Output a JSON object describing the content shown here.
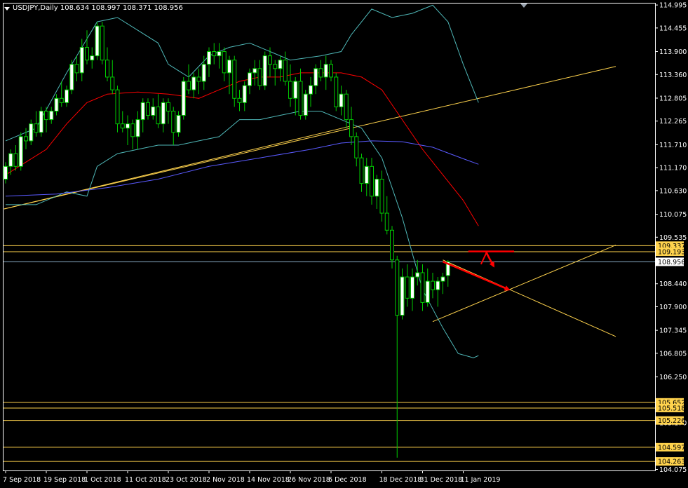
{
  "header": {
    "symbol_line": "USDJPY,Daily  108.634 108.997 108.371 108.956"
  },
  "colors": {
    "background": "#000000",
    "grid_border": "#ffffff",
    "bull_candle": "#ffffff",
    "bear_candle": "#000000",
    "wick": "#00cc00",
    "bollinger": "#4fb8b8",
    "ma_red": "#ff0000",
    "ma_blue": "#5a5aff",
    "trendline": "#ffd34d",
    "level_line": "#ffd34d",
    "price_line": "#8aaec8",
    "arrow": "#ff0000"
  },
  "chart_data": {
    "type": "candlestick",
    "symbol": "USDJPY",
    "timeframe": "Daily",
    "ohlc_header": {
      "open": 108.634,
      "high": 108.997,
      "low": 108.371,
      "close": 108.956
    },
    "ylim": [
      104.05,
      115.03
    ],
    "y_ticks": [
      114.995,
      114.455,
      113.9,
      113.36,
      112.805,
      112.265,
      111.71,
      111.17,
      110.63,
      110.075,
      109.535,
      108.44,
      107.9,
      107.345,
      106.805,
      106.25,
      105.17,
      104.075
    ],
    "x_ticks": [
      {
        "bar": 0,
        "label": "7 Sep 2018"
      },
      {
        "bar": 8,
        "label": "19 Sep 2018"
      },
      {
        "bar": 16,
        "label": "1 Oct 2018"
      },
      {
        "bar": 24,
        "label": "11 Oct 2018"
      },
      {
        "bar": 32,
        "label": "23 Oct 2018"
      },
      {
        "bar": 40,
        "label": "2 Nov 2018"
      },
      {
        "bar": 48,
        "label": "14 Nov 2018"
      },
      {
        "bar": 56,
        "label": "26 Nov 2018"
      },
      {
        "bar": 64,
        "label": "6 Dec 2018"
      },
      {
        "bar": 74,
        "label": "18 Dec 2018"
      },
      {
        "bar": 82,
        "label": "31 Dec 2018"
      },
      {
        "bar": 90,
        "label": "11 Jan 2019"
      }
    ],
    "current_price": 108.956,
    "levels": [
      {
        "price": 109.337,
        "label": "109.337"
      },
      {
        "price": 109.193,
        "label": "109.193"
      },
      {
        "price": 105.652,
        "label": "105.652"
      },
      {
        "price": 105.518,
        "label": "105.518"
      },
      {
        "price": 105.226,
        "label": "105.226"
      },
      {
        "price": 104.597,
        "label": "104.597"
      },
      {
        "price": 104.263,
        "label": "104.263"
      }
    ],
    "candles": [
      [
        110.9,
        111.3,
        110.8,
        111.2
      ],
      [
        111.2,
        111.6,
        111.0,
        111.5
      ],
      [
        111.5,
        111.7,
        111.1,
        111.2
      ],
      [
        111.2,
        112.0,
        111.1,
        111.9
      ],
      [
        111.9,
        112.1,
        111.6,
        111.8
      ],
      [
        111.8,
        112.3,
        111.7,
        112.2
      ],
      [
        112.2,
        112.5,
        111.9,
        112.0
      ],
      [
        112.0,
        112.6,
        111.9,
        112.5
      ],
      [
        112.5,
        112.6,
        112.0,
        112.3
      ],
      [
        112.3,
        112.6,
        112.2,
        112.5
      ],
      [
        112.5,
        112.9,
        112.4,
        112.8
      ],
      [
        112.8,
        113.2,
        112.6,
        112.7
      ],
      [
        112.7,
        113.1,
        112.6,
        113.0
      ],
      [
        113.0,
        113.7,
        112.9,
        113.6
      ],
      [
        113.6,
        113.8,
        113.2,
        113.4
      ],
      [
        113.4,
        114.2,
        113.2,
        114.0
      ],
      [
        114.0,
        114.4,
        113.6,
        113.7
      ],
      [
        113.7,
        114.0,
        113.5,
        113.8
      ],
      [
        113.8,
        114.6,
        113.7,
        114.5
      ],
      [
        114.5,
        114.6,
        113.6,
        113.7
      ],
      [
        113.7,
        114.0,
        113.2,
        113.3
      ],
      [
        113.3,
        113.7,
        112.9,
        113.0
      ],
      [
        113.0,
        113.1,
        112.0,
        112.2
      ],
      [
        112.2,
        112.5,
        112.0,
        112.1
      ],
      [
        112.1,
        112.4,
        111.7,
        112.2
      ],
      [
        112.2,
        112.3,
        111.6,
        111.9
      ],
      [
        111.9,
        112.5,
        111.6,
        112.3
      ],
      [
        112.3,
        112.8,
        112.0,
        112.7
      ],
      [
        112.7,
        112.8,
        112.3,
        112.4
      ],
      [
        112.4,
        112.8,
        112.3,
        112.6
      ],
      [
        112.6,
        112.9,
        112.1,
        112.2
      ],
      [
        112.2,
        112.8,
        112.0,
        112.7
      ],
      [
        112.7,
        112.8,
        112.2,
        112.5
      ],
      [
        112.5,
        112.6,
        111.7,
        112.0
      ],
      [
        112.0,
        112.5,
        111.9,
        112.4
      ],
      [
        112.4,
        113.3,
        112.3,
        113.2
      ],
      [
        113.2,
        113.6,
        112.9,
        113.0
      ],
      [
        113.0,
        113.4,
        112.8,
        113.3
      ],
      [
        113.3,
        113.5,
        112.9,
        113.2
      ],
      [
        113.2,
        113.8,
        113.0,
        113.6
      ],
      [
        113.6,
        114.0,
        113.3,
        113.9
      ],
      [
        113.9,
        114.1,
        113.6,
        113.8
      ],
      [
        113.8,
        114.1,
        113.5,
        113.9
      ],
      [
        113.9,
        114.0,
        113.2,
        113.4
      ],
      [
        113.4,
        113.8,
        112.9,
        113.7
      ],
      [
        113.7,
        113.8,
        112.6,
        112.8
      ],
      [
        112.8,
        113.0,
        112.5,
        112.7
      ],
      [
        112.7,
        113.2,
        112.5,
        113.1
      ],
      [
        113.1,
        113.5,
        112.9,
        113.4
      ],
      [
        113.4,
        113.7,
        113.1,
        113.5
      ],
      [
        113.5,
        113.7,
        113.0,
        113.1
      ],
      [
        113.1,
        113.9,
        113.0,
        113.8
      ],
      [
        113.8,
        114.0,
        113.3,
        113.6
      ],
      [
        113.6,
        113.7,
        113.1,
        113.5
      ],
      [
        113.5,
        113.8,
        113.2,
        113.7
      ],
      [
        113.7,
        113.9,
        113.1,
        113.2
      ],
      [
        113.2,
        113.6,
        112.6,
        112.8
      ],
      [
        112.8,
        113.3,
        112.4,
        113.2
      ],
      [
        113.2,
        113.5,
        112.3,
        112.4
      ],
      [
        112.4,
        113.0,
        112.3,
        112.9
      ],
      [
        112.9,
        113.3,
        112.6,
        113.1
      ],
      [
        113.1,
        113.6,
        112.9,
        113.5
      ],
      [
        113.5,
        113.7,
        113.2,
        113.3
      ],
      [
        113.3,
        113.8,
        113.0,
        113.6
      ],
      [
        113.6,
        113.7,
        113.2,
        113.3
      ],
      [
        113.3,
        113.4,
        112.5,
        112.6
      ],
      [
        112.6,
        113.1,
        112.4,
        112.9
      ],
      [
        112.9,
        113.0,
        112.1,
        112.3
      ],
      [
        112.3,
        112.6,
        111.7,
        111.9
      ],
      [
        111.9,
        112.0,
        111.2,
        111.4
      ],
      [
        111.4,
        111.5,
        110.6,
        110.8
      ],
      [
        110.8,
        111.4,
        110.5,
        111.2
      ],
      [
        111.2,
        111.4,
        110.3,
        110.5
      ],
      [
        110.5,
        111.0,
        110.2,
        110.9
      ],
      [
        110.9,
        111.1,
        109.9,
        110.1
      ],
      [
        110.1,
        110.5,
        109.6,
        109.7
      ],
      [
        109.7,
        109.8,
        108.8,
        109.0
      ],
      [
        109.0,
        109.1,
        104.35,
        107.7
      ],
      [
        107.7,
        108.8,
        107.6,
        108.6
      ],
      [
        108.6,
        108.9,
        107.9,
        108.1
      ],
      [
        108.1,
        108.8,
        107.8,
        108.6
      ],
      [
        108.6,
        109.0,
        108.4,
        108.7
      ],
      [
        108.7,
        108.9,
        107.8,
        108.0
      ],
      [
        108.0,
        108.8,
        107.9,
        108.5
      ],
      [
        108.5,
        108.7,
        108.1,
        108.3
      ],
      [
        108.3,
        108.6,
        107.9,
        108.5
      ],
      [
        108.5,
        108.7,
        108.2,
        108.6
      ],
      [
        108.634,
        108.997,
        108.371,
        108.956
      ]
    ],
    "bollinger_upper": [
      [
        0,
        111.8
      ],
      [
        6,
        112.1
      ],
      [
        12,
        113.4
      ],
      [
        18,
        114.6
      ],
      [
        22,
        114.7
      ],
      [
        26,
        114.4
      ],
      [
        30,
        114.1
      ],
      [
        32,
        113.6
      ],
      [
        36,
        113.3
      ],
      [
        40,
        113.8
      ],
      [
        44,
        114.0
      ],
      [
        48,
        114.1
      ],
      [
        52,
        113.9
      ],
      [
        56,
        113.7
      ],
      [
        62,
        113.8
      ],
      [
        66,
        113.9
      ],
      [
        68,
        114.3
      ],
      [
        72,
        114.9
      ],
      [
        76,
        114.7
      ],
      [
        80,
        114.8
      ],
      [
        84,
        114.99
      ],
      [
        87,
        114.6
      ],
      [
        90,
        113.6
      ],
      [
        93,
        112.7
      ]
    ],
    "bollinger_lower": [
      [
        0,
        110.3
      ],
      [
        6,
        110.3
      ],
      [
        12,
        110.6
      ],
      [
        16,
        110.5
      ],
      [
        18,
        111.2
      ],
      [
        22,
        111.5
      ],
      [
        26,
        111.6
      ],
      [
        30,
        111.7
      ],
      [
        34,
        111.7
      ],
      [
        38,
        111.8
      ],
      [
        42,
        111.9
      ],
      [
        46,
        112.3
      ],
      [
        50,
        112.3
      ],
      [
        54,
        112.4
      ],
      [
        58,
        112.5
      ],
      [
        62,
        112.5
      ],
      [
        66,
        112.3
      ],
      [
        70,
        112.1
      ],
      [
        74,
        111.4
      ],
      [
        78,
        110.0
      ],
      [
        82,
        108.3
      ],
      [
        86,
        107.4
      ],
      [
        89,
        106.8
      ],
      [
        92,
        106.7
      ],
      [
        93,
        106.75
      ]
    ],
    "ma_red": [
      [
        0,
        111.0
      ],
      [
        4,
        111.3
      ],
      [
        8,
        111.6
      ],
      [
        12,
        112.2
      ],
      [
        16,
        112.7
      ],
      [
        20,
        112.9
      ],
      [
        26,
        112.95
      ],
      [
        32,
        112.9
      ],
      [
        38,
        112.8
      ],
      [
        42,
        113.0
      ],
      [
        46,
        113.2
      ],
      [
        50,
        113.3
      ],
      [
        54,
        113.3
      ],
      [
        58,
        113.4
      ],
      [
        62,
        113.4
      ],
      [
        66,
        113.4
      ],
      [
        70,
        113.3
      ],
      [
        74,
        113.0
      ],
      [
        78,
        112.3
      ],
      [
        82,
        111.6
      ],
      [
        86,
        111.0
      ],
      [
        90,
        110.4
      ],
      [
        92,
        110.0
      ],
      [
        93,
        109.8
      ]
    ],
    "ma_blue": [
      [
        0,
        110.5
      ],
      [
        10,
        110.55
      ],
      [
        20,
        110.7
      ],
      [
        30,
        110.9
      ],
      [
        40,
        111.2
      ],
      [
        50,
        111.4
      ],
      [
        60,
        111.6
      ],
      [
        66,
        111.75
      ],
      [
        72,
        111.8
      ],
      [
        78,
        111.78
      ],
      [
        84,
        111.65
      ],
      [
        90,
        111.38
      ],
      [
        93,
        111.25
      ]
    ],
    "trendlines": [
      {
        "points": [
          [
            -0.3,
            110.2
          ],
          [
            120,
            113.55
          ]
        ]
      },
      {
        "points": [
          [
            -0.3,
            110.2
          ],
          [
            68,
            112.15
          ]
        ]
      },
      {
        "points": [
          [
            84,
            107.55
          ],
          [
            120,
            109.35
          ]
        ]
      },
      {
        "points": [
          [
            86,
            109.0
          ],
          [
            120,
            107.2
          ]
        ]
      }
    ],
    "arrow_annotations": [
      {
        "type": "line",
        "from": [
          91,
          109.2
        ],
        "to": [
          100,
          109.2
        ]
      },
      {
        "type": "arrow",
        "from": [
          86,
          108.96
        ],
        "to": [
          99,
          108.3
        ]
      },
      {
        "type": "arrow",
        "from": [
          94.5,
          109.18
        ],
        "to": [
          96,
          108.85
        ]
      }
    ]
  }
}
